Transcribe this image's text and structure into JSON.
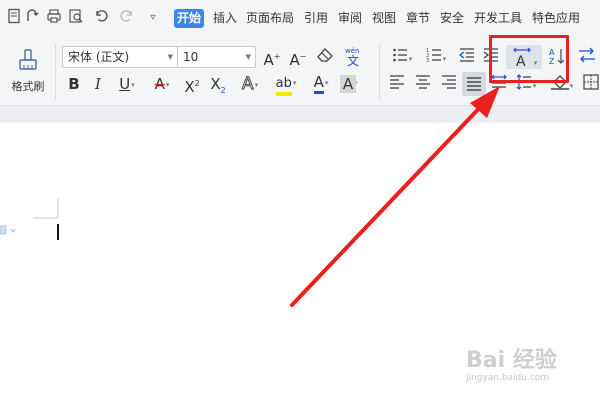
{
  "menu": {
    "tabs": [
      "开始",
      "插入",
      "页面布局",
      "引用",
      "审阅",
      "视图",
      "章节",
      "安全",
      "开发工具",
      "特色应用"
    ],
    "active_tab": "开始"
  },
  "font": {
    "name": "宋体 (正文)",
    "size": "10"
  },
  "format_painter": {
    "label": "格式刷"
  },
  "watermark": {
    "text": "Bai 经验",
    "url": "jingyan.baidu.com"
  },
  "colors": {
    "accent": "#3a87e6",
    "highlight_box": "#e8211f",
    "arrow": "#e8211f",
    "highlight_yellow": "#f5e900",
    "font_red": "#e02020",
    "font_blue": "#1a4fd6"
  },
  "icons": [
    "document-icon",
    "redo-shape-icon",
    "print-icon",
    "print-preview-icon",
    "undo-icon",
    "redo-icon",
    "customize-icon",
    "format-painter-icon",
    "grow-font-icon",
    "shrink-font-icon",
    "clear-format-icon",
    "pinyin-icon",
    "bold-icon",
    "italic-icon",
    "underline-icon",
    "strikethrough-icon",
    "superscript-icon",
    "subscript-icon",
    "text-effect-icon",
    "highlight-icon",
    "font-color-icon",
    "character-shading-icon",
    "bullets-icon",
    "numbering-icon",
    "decrease-indent-icon",
    "increase-indent-icon",
    "character-spacing-icon",
    "sort-icon",
    "text-direction-icon",
    "align-left-icon",
    "align-center-icon",
    "align-right-icon",
    "justify-icon",
    "distributed-icon",
    "line-spacing-icon",
    "shading-icon",
    "borders-icon"
  ]
}
